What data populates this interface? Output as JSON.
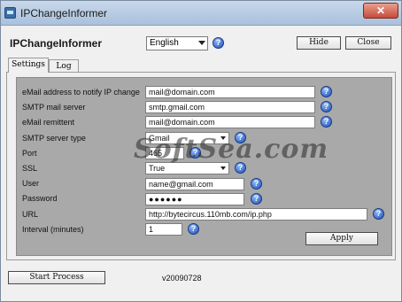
{
  "window": {
    "title": "IPChangeInformer",
    "close_label": "✕"
  },
  "header": {
    "app_name": "IPChangeInformer",
    "language": "English",
    "hide_label": "Hide",
    "close_label": "Close"
  },
  "tabs": [
    {
      "label": "Settings"
    },
    {
      "label": "Log"
    }
  ],
  "settings": {
    "email_notify": {
      "label": "eMail address to notify IP change",
      "value": "mail@domain.com"
    },
    "smtp_server": {
      "label": "SMTP mail server",
      "value": "smtp.gmail.com"
    },
    "remittent": {
      "label": "eMail remittent",
      "value": "mail@domain.com"
    },
    "smtp_type": {
      "label": "SMTP server type",
      "value": "Gmail"
    },
    "port": {
      "label": "Port",
      "value": "465"
    },
    "ssl": {
      "label": "SSL",
      "value": "True"
    },
    "user": {
      "label": "User",
      "value": "name@gmail.com"
    },
    "password": {
      "label": "Password",
      "value": "●●●●●●"
    },
    "url": {
      "label": "URL",
      "value": "http://bytecircus.110mb.com/ip.php"
    },
    "interval": {
      "label": "Interval (minutes)",
      "value": "1"
    },
    "apply_label": "Apply"
  },
  "footer": {
    "start_label": "Start Process",
    "version": "v20090728"
  },
  "watermark": "SoftSea.com",
  "help_glyph": "?",
  "icons": {
    "help": "help-icon",
    "app": "app-icon"
  }
}
